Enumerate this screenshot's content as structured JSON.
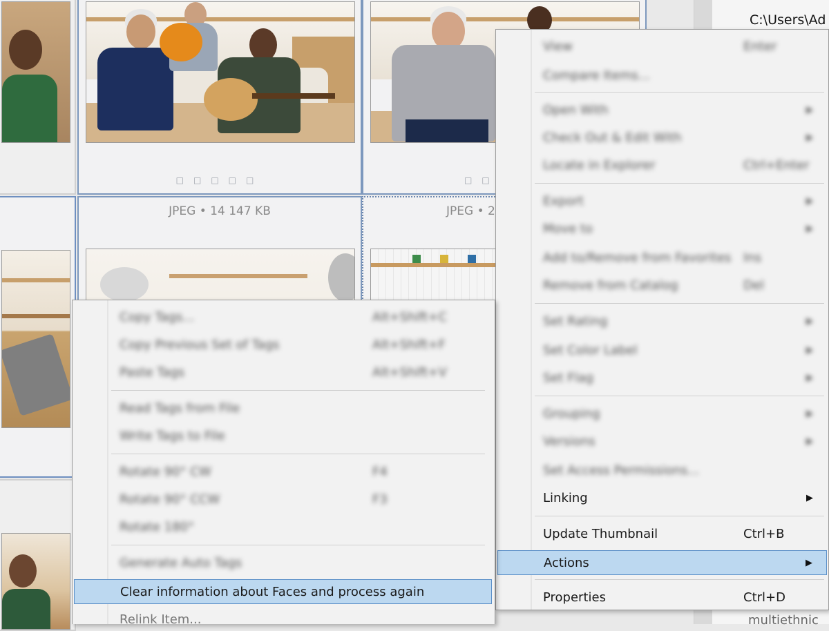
{
  "background": {
    "path_text": "C:\\Users\\Ad",
    "bottom_text": "multiethnic",
    "caption_1": "JPEG • 14 147 KB",
    "caption_2": "JPEG • 2"
  },
  "main_menu": {
    "items": [
      {
        "label": "View",
        "shortcut": "Enter",
        "submenu": false,
        "blurred": true
      },
      {
        "label": "Compare Items...",
        "shortcut": "",
        "submenu": false,
        "blurred": true
      },
      {
        "label": "Open With",
        "shortcut": "",
        "submenu": true,
        "blurred": true
      },
      {
        "label": "Check Out & Edit With",
        "shortcut": "",
        "submenu": true,
        "blurred": true
      },
      {
        "label": "Locate in Explorer",
        "shortcut": "Ctrl+Enter",
        "submenu": false,
        "blurred": true
      },
      {
        "label": "Export",
        "shortcut": "",
        "submenu": true,
        "blurred": true
      },
      {
        "label": "Move to",
        "shortcut": "",
        "submenu": true,
        "blurred": true
      },
      {
        "label": "Add to/Remove from Favorites",
        "shortcut": "Ins",
        "submenu": false,
        "blurred": true
      },
      {
        "label": "Remove from Catalog",
        "shortcut": "Del",
        "submenu": false,
        "blurred": true
      },
      {
        "label": "Set Rating",
        "shortcut": "",
        "submenu": true,
        "blurred": true
      },
      {
        "label": "Set Color Label",
        "shortcut": "",
        "submenu": true,
        "blurred": true
      },
      {
        "label": "Set Flag",
        "shortcut": "",
        "submenu": true,
        "blurred": true
      },
      {
        "label": "Grouping",
        "shortcut": "",
        "submenu": true,
        "blurred": true
      },
      {
        "label": "Versions",
        "shortcut": "",
        "submenu": true,
        "blurred": true
      },
      {
        "label": "Set Access Permissions...",
        "shortcut": "",
        "submenu": false,
        "blurred": true
      },
      {
        "label": "Linking",
        "shortcut": "",
        "submenu": true,
        "blurred": false
      },
      {
        "label": "Update Thumbnail",
        "shortcut": "Ctrl+B",
        "submenu": false,
        "blurred": false
      },
      {
        "label": "Actions",
        "shortcut": "",
        "submenu": true,
        "blurred": false,
        "highlighted": true
      },
      {
        "label": "Properties",
        "shortcut": "Ctrl+D",
        "submenu": false,
        "blurred": false
      }
    ]
  },
  "sub_menu": {
    "items": [
      {
        "label": "Copy Tags...",
        "shortcut": "Alt+Shift+C",
        "blurred": true
      },
      {
        "label": "Copy Previous Set of Tags",
        "shortcut": "Alt+Shift+F",
        "blurred": true
      },
      {
        "label": "Paste Tags",
        "shortcut": "Alt+Shift+V",
        "blurred": true
      },
      {
        "label": "Read Tags from File",
        "shortcut": "",
        "blurred": true
      },
      {
        "label": "Write Tags to File",
        "shortcut": "",
        "blurred": true
      },
      {
        "label": "Rotate 90° CW",
        "shortcut": "F4",
        "blurred": true
      },
      {
        "label": "Rotate 90° CCW",
        "shortcut": "F3",
        "blurred": true
      },
      {
        "label": "Rotate 180°",
        "shortcut": "",
        "blurred": true
      },
      {
        "label": "Generate Auto Tags",
        "shortcut": "",
        "blurred": true
      },
      {
        "label": "Clear information about Faces and process again",
        "shortcut": "",
        "blurred": false,
        "highlighted": true
      },
      {
        "label": "Relink Item...",
        "shortcut": "",
        "blurred": false,
        "dim": true
      }
    ]
  },
  "colors": {
    "highlight_fill": "#bcd8f0",
    "highlight_border": "#5a8fc8",
    "selection_border": "#7d98bd"
  }
}
